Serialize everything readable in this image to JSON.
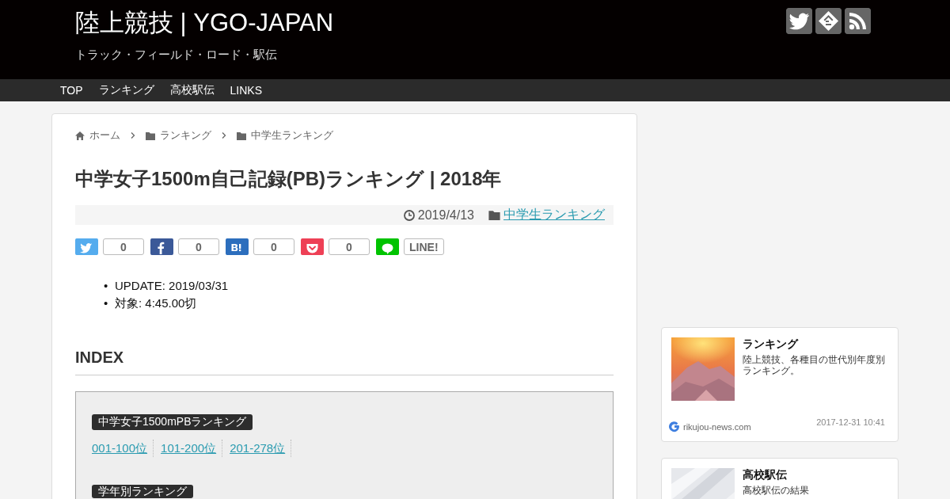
{
  "header": {
    "site_title": "陸上競技 | YGO-JAPAN",
    "tagline": "トラック・フィールド・ロード・駅伝",
    "social_icons": [
      {
        "kind": "twitter"
      },
      {
        "kind": "feedly"
      },
      {
        "kind": "rss"
      }
    ]
  },
  "nav": {
    "items": [
      {
        "label": "TOP"
      },
      {
        "label": "ランキング"
      },
      {
        "label": "高校駅伝"
      },
      {
        "label": "LINKS"
      }
    ]
  },
  "breadcrumb": [
    {
      "kind": "home",
      "label": "ホーム"
    },
    {
      "kind": "folder",
      "label": "ランキング"
    },
    {
      "kind": "folder",
      "label": "中学生ランキング"
    }
  ],
  "article": {
    "title": "中学女子1500m自己記録(PB)ランキング | 2018年",
    "date": "2019/4/13",
    "category": "中学生ランキング",
    "share": [
      {
        "kind": "twitter",
        "color": "#55acee",
        "count": "0"
      },
      {
        "kind": "facebook",
        "color": "#3b5998",
        "count": "0"
      },
      {
        "kind": "hatena",
        "color": "#2c6ebd",
        "count": "0"
      },
      {
        "kind": "pocket",
        "color": "#ee4056",
        "count": "0"
      },
      {
        "kind": "line",
        "color": "#00c300",
        "count": "LINE!"
      }
    ],
    "bullets": [
      {
        "marker": "•",
        "text": "UPDATE: 2019/03/31"
      },
      {
        "marker": "•",
        "text": "対象: 4:45.00切"
      }
    ],
    "index_heading": "INDEX",
    "index_groups": [
      {
        "label": "中学女子1500mPBランキング",
        "links": [
          "001-100位",
          "101-200位",
          "201-278位"
        ]
      },
      {
        "label": "学年別ランキング"
      }
    ]
  },
  "sidebar": {
    "cards": [
      {
        "title": "ランキング",
        "description": "陸上競技、各種目の世代別年度別ランキング。",
        "source": "rikujou-news.com",
        "date": "2017-12-31 10:41",
        "kind": "sunset"
      },
      {
        "title": "高校駅伝",
        "description": "高校駅伝の結果",
        "kind": "cloth"
      }
    ]
  }
}
